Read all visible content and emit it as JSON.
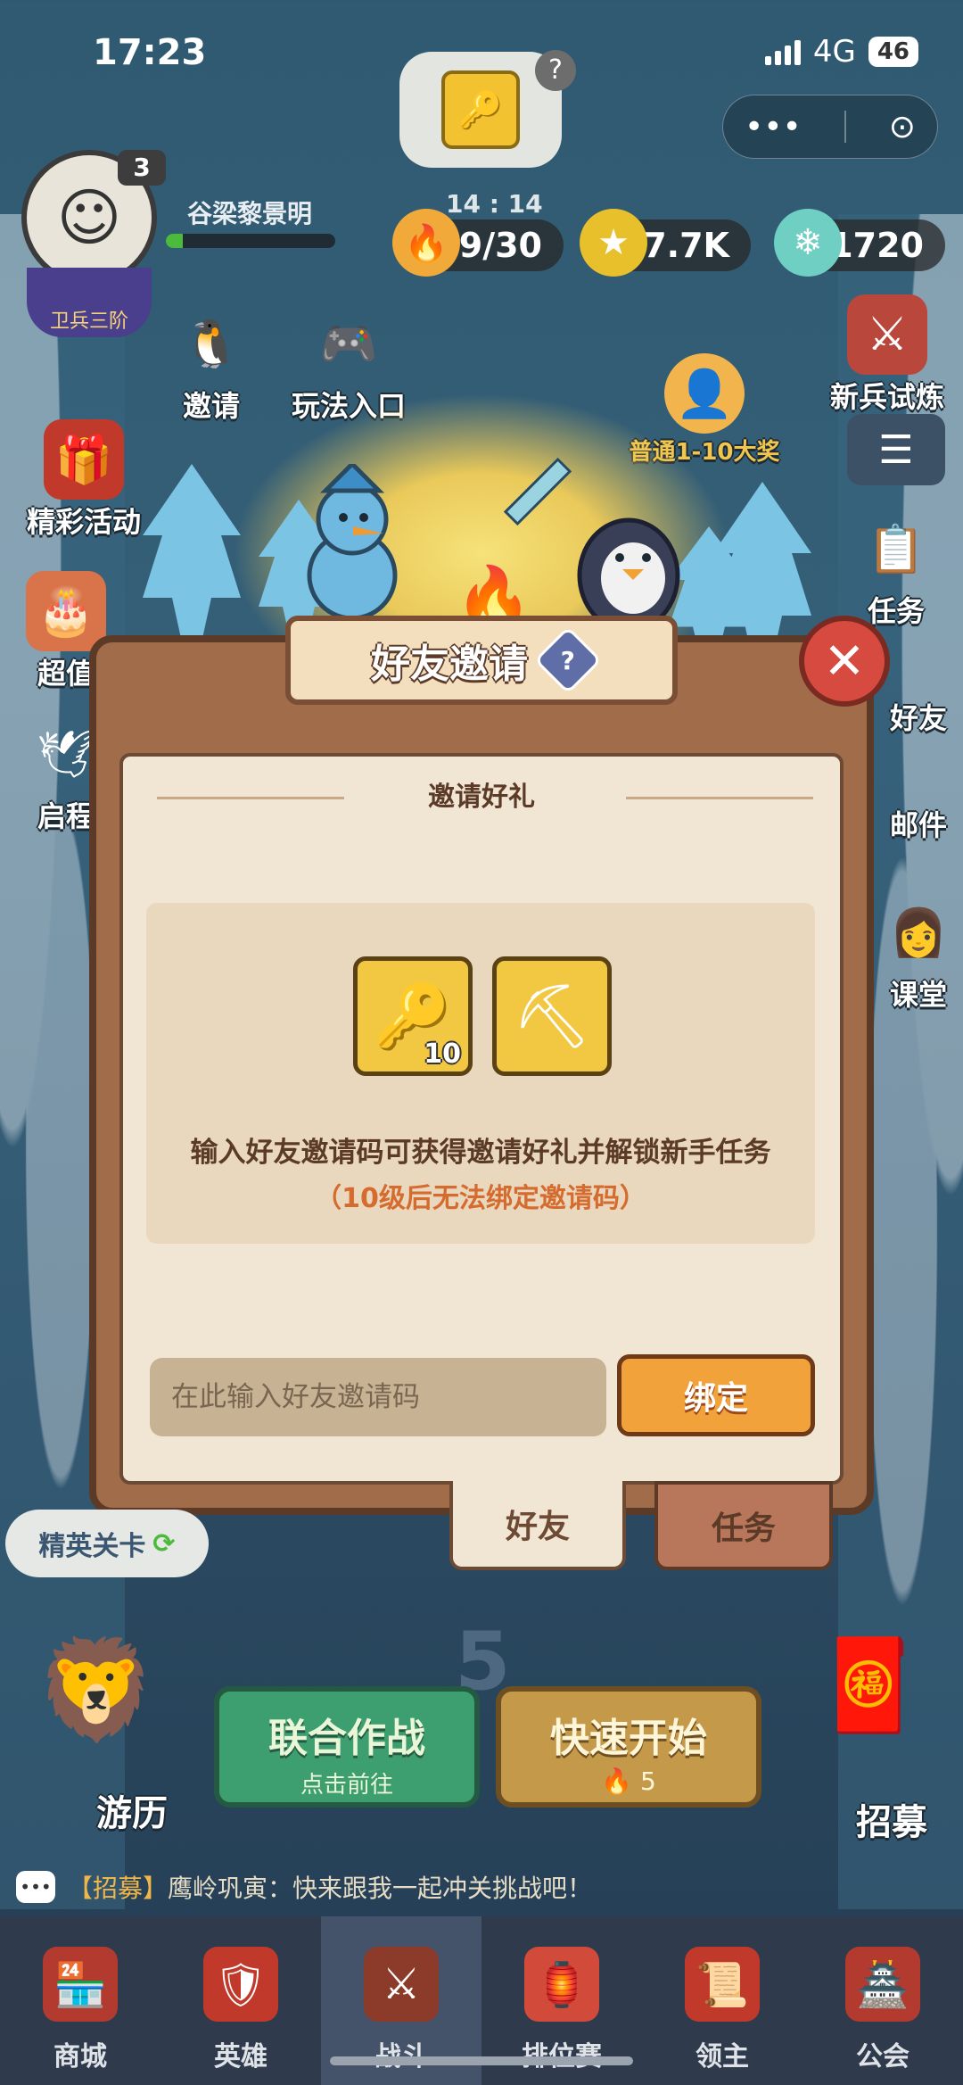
{
  "status_bar": {
    "time": "17:23",
    "network": "4G",
    "battery": "46"
  },
  "capsule": {
    "more": "•••",
    "close": "⊙"
  },
  "player": {
    "name": "谷梁黎景明",
    "level": "3",
    "rank": "卫兵三阶",
    "xp_fraction": 0.1
  },
  "hud": {
    "timer": "14 : 14",
    "stamina": "19/30",
    "gold": "7.7K",
    "gems": "1720"
  },
  "left_menu": {
    "invite": "邀请",
    "gameplay": "玩法入口",
    "events": "精彩活动",
    "value": "超值",
    "journey": "启程"
  },
  "right_menu": {
    "trial": "新兵试炼",
    "big_prize": "普通1-10大奖",
    "tasks": "任务",
    "friends": "好友",
    "mail": "邮件",
    "classroom": "课堂"
  },
  "modal": {
    "title": "好友邀请",
    "help": "?",
    "close": "✕",
    "section_title": "邀请好礼",
    "reward_key_count": "10",
    "description": "输入好友邀请码可获得邀请好礼并解锁新手任务",
    "note": "（10级后无法绑定邀请码）",
    "input_placeholder": "在此输入好友邀请码",
    "bind_button": "绑定",
    "tab_friends": "好友",
    "tab_tasks": "任务"
  },
  "stage": {
    "elite": "精英关卡",
    "number": "5",
    "coop_title": "联合作战",
    "coop_sub": "点击前往",
    "quick_title": "快速开始",
    "quick_cost": "5",
    "travel": "游历",
    "recruit": "招募"
  },
  "chat": {
    "tag": "【招募】",
    "message": "鹰岭巩寅：快来跟我一起冲关挑战吧！"
  },
  "bottom_nav": [
    "商城",
    "英雄",
    "战斗",
    "排位赛",
    "领主",
    "公会"
  ]
}
